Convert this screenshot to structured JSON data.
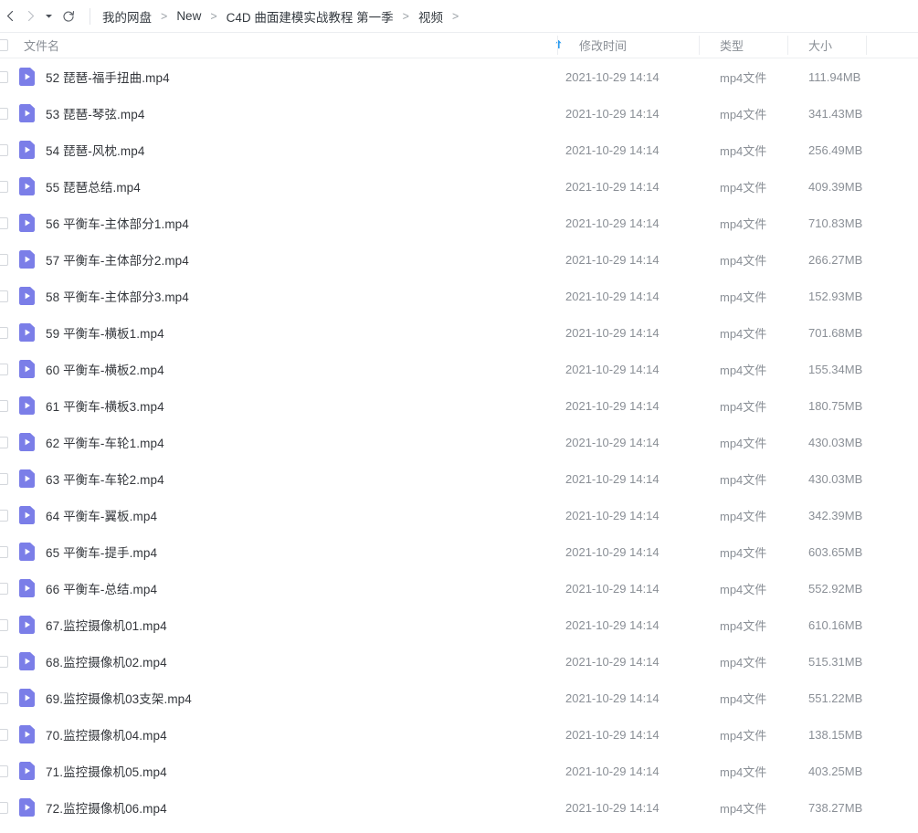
{
  "toolbar": {
    "back_icon": "chevron-left-icon",
    "forward_icon": "chevron-right-icon",
    "history_caret_icon": "caret-down-icon",
    "refresh_icon": "refresh-icon"
  },
  "breadcrumb": {
    "separator": ">",
    "items": [
      "我的网盘",
      "New",
      "C4D 曲面建模实战教程 第一季",
      "视频"
    ],
    "trailing_separator": ">"
  },
  "columns": {
    "name": "文件名",
    "sort_indicator": "↑",
    "modified": "修改时间",
    "type": "类型",
    "size": "大小"
  },
  "colors": {
    "accent": "#2b9cf0",
    "file_icon": "#7b7ee8",
    "text_primary": "#34373c",
    "text_secondary": "#8a8f96",
    "border": "#eceef1"
  },
  "files": [
    {
      "name": "52 琵琶-福手扭曲.mp4",
      "modified": "2021-10-29 14:14",
      "type": "mp4文件",
      "size": "111.94MB",
      "icon": "video-file-icon"
    },
    {
      "name": "53 琵琶-琴弦.mp4",
      "modified": "2021-10-29 14:14",
      "type": "mp4文件",
      "size": "341.43MB",
      "icon": "video-file-icon"
    },
    {
      "name": "54 琵琶-风枕.mp4",
      "modified": "2021-10-29 14:14",
      "type": "mp4文件",
      "size": "256.49MB",
      "icon": "video-file-icon"
    },
    {
      "name": "55 琵琶总结.mp4",
      "modified": "2021-10-29 14:14",
      "type": "mp4文件",
      "size": "409.39MB",
      "icon": "video-file-icon"
    },
    {
      "name": "56 平衡车-主体部分1.mp4",
      "modified": "2021-10-29 14:14",
      "type": "mp4文件",
      "size": "710.83MB",
      "icon": "video-file-icon"
    },
    {
      "name": "57 平衡车-主体部分2.mp4",
      "modified": "2021-10-29 14:14",
      "type": "mp4文件",
      "size": "266.27MB",
      "icon": "video-file-icon"
    },
    {
      "name": "58 平衡车-主体部分3.mp4",
      "modified": "2021-10-29 14:14",
      "type": "mp4文件",
      "size": "152.93MB",
      "icon": "video-file-icon"
    },
    {
      "name": "59 平衡车-横板1.mp4",
      "modified": "2021-10-29 14:14",
      "type": "mp4文件",
      "size": "701.68MB",
      "icon": "video-file-icon"
    },
    {
      "name": "60 平衡车-横板2.mp4",
      "modified": "2021-10-29 14:14",
      "type": "mp4文件",
      "size": "155.34MB",
      "icon": "video-file-icon"
    },
    {
      "name": "61 平衡车-横板3.mp4",
      "modified": "2021-10-29 14:14",
      "type": "mp4文件",
      "size": "180.75MB",
      "icon": "video-file-icon"
    },
    {
      "name": "62 平衡车-车轮1.mp4",
      "modified": "2021-10-29 14:14",
      "type": "mp4文件",
      "size": "430.03MB",
      "icon": "video-file-icon"
    },
    {
      "name": "63 平衡车-车轮2.mp4",
      "modified": "2021-10-29 14:14",
      "type": "mp4文件",
      "size": "430.03MB",
      "icon": "video-file-icon"
    },
    {
      "name": "64 平衡车-翼板.mp4",
      "modified": "2021-10-29 14:14",
      "type": "mp4文件",
      "size": "342.39MB",
      "icon": "video-file-icon"
    },
    {
      "name": "65 平衡车-提手.mp4",
      "modified": "2021-10-29 14:14",
      "type": "mp4文件",
      "size": "603.65MB",
      "icon": "video-file-icon"
    },
    {
      "name": "66 平衡车-总结.mp4",
      "modified": "2021-10-29 14:14",
      "type": "mp4文件",
      "size": "552.92MB",
      "icon": "video-file-icon"
    },
    {
      "name": "67.监控摄像机01.mp4",
      "modified": "2021-10-29 14:14",
      "type": "mp4文件",
      "size": "610.16MB",
      "icon": "video-file-icon"
    },
    {
      "name": "68.监控摄像机02.mp4",
      "modified": "2021-10-29 14:14",
      "type": "mp4文件",
      "size": "515.31MB",
      "icon": "video-file-icon"
    },
    {
      "name": "69.监控摄像机03支架.mp4",
      "modified": "2021-10-29 14:14",
      "type": "mp4文件",
      "size": "551.22MB",
      "icon": "video-file-icon"
    },
    {
      "name": "70.监控摄像机04.mp4",
      "modified": "2021-10-29 14:14",
      "type": "mp4文件",
      "size": "138.15MB",
      "icon": "video-file-icon"
    },
    {
      "name": "71.监控摄像机05.mp4",
      "modified": "2021-10-29 14:14",
      "type": "mp4文件",
      "size": "403.25MB",
      "icon": "video-file-icon"
    },
    {
      "name": "72.监控摄像机06.mp4",
      "modified": "2021-10-29 14:14",
      "type": "mp4文件",
      "size": "738.27MB",
      "icon": "video-file-icon"
    }
  ]
}
